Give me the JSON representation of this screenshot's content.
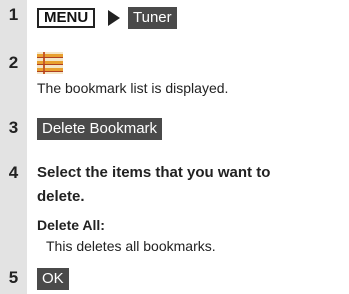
{
  "steps": [
    {
      "number": "1"
    },
    {
      "number": "2"
    },
    {
      "number": "3"
    },
    {
      "number": "4"
    },
    {
      "number": "5"
    }
  ],
  "step1": {
    "menu_label": "MENU",
    "tuner_label": "Tuner"
  },
  "step2": {
    "icon": "bookmark-list-icon",
    "text": "The bookmark list is displayed."
  },
  "step3": {
    "button_label": "Delete Bookmark"
  },
  "step4": {
    "instruction_line1": "Select the items that you want to",
    "instruction_line2": "delete.",
    "option_title": "Delete All:",
    "option_desc": "This deletes all bookmarks."
  },
  "step5": {
    "button_label": "OK"
  },
  "colors": {
    "rail": "#e3e3e3",
    "dark_button": "#4a4a4a",
    "icon_orange": "#e8a030"
  }
}
